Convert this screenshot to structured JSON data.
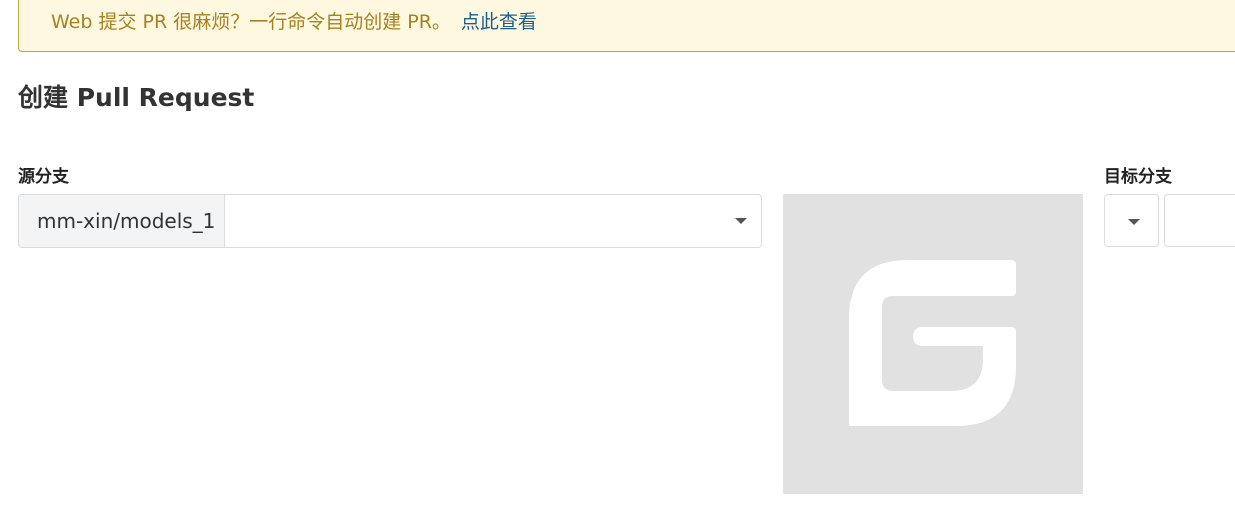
{
  "banner": {
    "text": "Web 提交 PR 很麻烦？一行命令自动创建 PR。",
    "link": "点此查看"
  },
  "page": {
    "title": "创建 Pull Request"
  },
  "source_branch": {
    "label": "源分支",
    "repo": "mm-xin/models_1",
    "branch": ""
  },
  "target_branch": {
    "label": "目标分支",
    "repo": "",
    "branch": ""
  },
  "icons": {
    "logo": "gitee-logo-icon",
    "dropdown": "caret-down-icon"
  },
  "colors": {
    "banner_bg": "#fff8e1",
    "banner_border": "#c9a23a",
    "banner_text": "#a6811f",
    "link": "#1b5e8c",
    "logo_bg": "#e1e1e1"
  }
}
